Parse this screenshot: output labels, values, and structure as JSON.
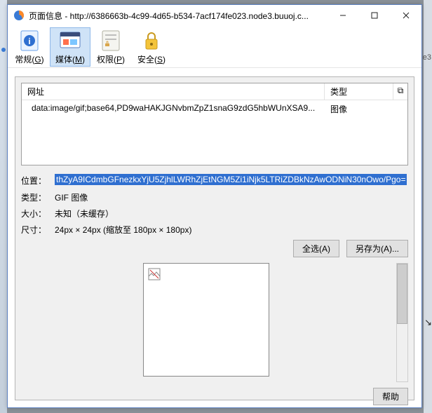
{
  "titlebar": {
    "title": "页面信息 - http://6386663b-4c99-4d65-b534-7acf174fe023.node3.buuoj.c..."
  },
  "toolbar": {
    "general": {
      "label": "常规",
      "accel": "G"
    },
    "media": {
      "label": "媒体",
      "accel": "M"
    },
    "perm": {
      "label": "权限",
      "accel": "P"
    },
    "sec": {
      "label": "安全",
      "accel": "S"
    }
  },
  "list": {
    "head_url": "网址",
    "head_type": "类型",
    "row0_url": "data:image/gif;base64,PD9waHAKJGNvbmZpZ1snaG9zdG5hbWUnXSA9... ",
    "row0_type": "图像"
  },
  "props": {
    "location_label": "位置：",
    "location_value": "thZyA9ICdmbGFnezkxYjU5ZjhlLWRhZjEtNGM5Zi1iNjk5LTRiZDBkNzAwODNiN30nOwo/Pgo=",
    "type_label": "类型：",
    "type_value": "GIF 图像",
    "size_label": "大小：",
    "size_value": "未知（未缓存）",
    "dim_label": "尺寸：",
    "dim_value": "24px × 24px (缩放至 180px × 180px)"
  },
  "buttons": {
    "select_all": "全选(A)",
    "save_as": "另存为(A)...",
    "help": "帮助"
  }
}
